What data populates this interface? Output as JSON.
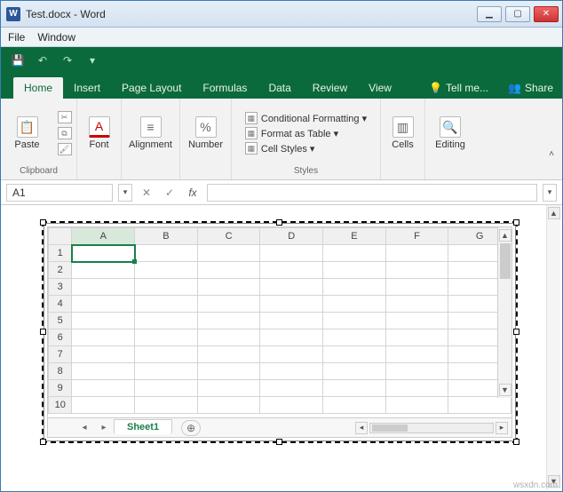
{
  "window": {
    "app_icon_letter": "W",
    "title": "Test.docx - Word"
  },
  "menubar": {
    "file": "File",
    "window": "Window"
  },
  "tabs": {
    "home": "Home",
    "insert": "Insert",
    "page_layout": "Page Layout",
    "formulas": "Formulas",
    "data": "Data",
    "review": "Review",
    "view": "View",
    "tell_me": "Tell me...",
    "share": "Share"
  },
  "ribbon": {
    "clipboard": {
      "paste": "Paste",
      "label": "Clipboard"
    },
    "font": {
      "btn": "Font",
      "label": "Font"
    },
    "alignment": {
      "btn": "Alignment",
      "label": ""
    },
    "number": {
      "btn": "Number",
      "label": ""
    },
    "styles": {
      "cond": "Conditional Formatting ▾",
      "table": "Format as Table ▾",
      "cell": "Cell Styles ▾",
      "label": "Styles"
    },
    "cells": {
      "btn": "Cells",
      "label": ""
    },
    "editing": {
      "btn": "Editing",
      "label": ""
    }
  },
  "namebox": "A1",
  "sheet": {
    "tab": "Sheet1",
    "columns": [
      "A",
      "B",
      "C",
      "D",
      "E",
      "F",
      "G"
    ],
    "rows": [
      "1",
      "2",
      "3",
      "4",
      "5",
      "6",
      "7",
      "8",
      "9",
      "10"
    ]
  },
  "watermark": "wsxdn.com"
}
